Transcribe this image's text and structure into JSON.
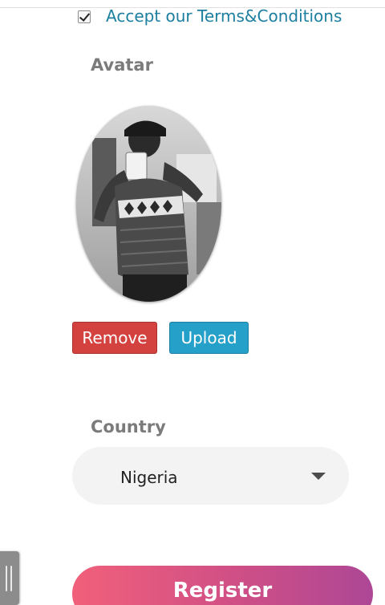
{
  "terms": {
    "checked": true,
    "label": "Accept our Terms&Conditions"
  },
  "avatar": {
    "label": "Avatar",
    "image_alt": "profile photo"
  },
  "buttons": {
    "remove": "Remove",
    "upload": "Upload"
  },
  "country": {
    "label": "Country",
    "selected": "Nigeria",
    "caret_icon": "caret-down-icon"
  },
  "register": {
    "label": "Register"
  },
  "colors": {
    "terms_link": "#1d7fa0",
    "remove_button": "#d3423e",
    "upload_button": "#25a0c9",
    "register_start": "#f1607a",
    "register_end": "#ad4796",
    "section_label": "#7b7b7b"
  }
}
